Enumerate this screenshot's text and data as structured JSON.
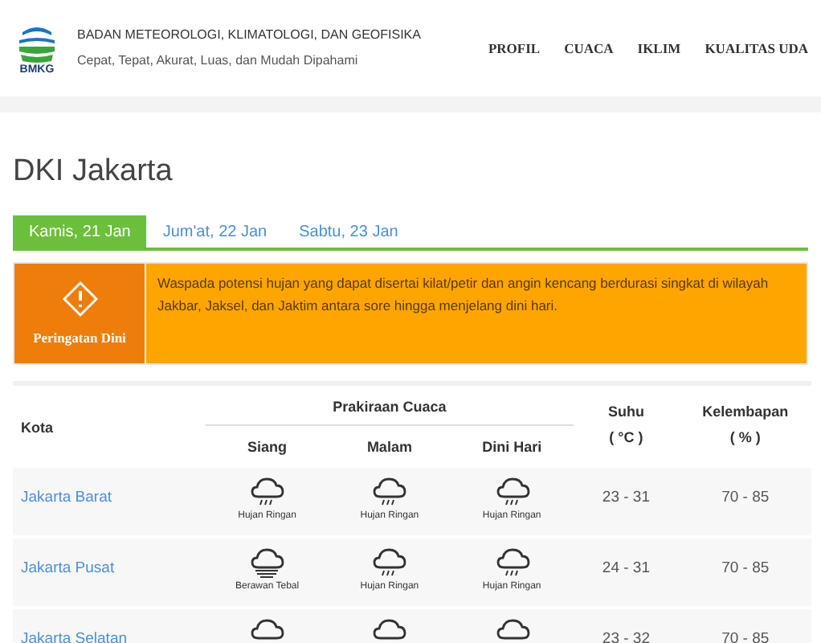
{
  "header": {
    "org_name": "BADAN METEOROLOGI, KLIMATOLOGI, DAN GEOFISIKA",
    "tagline": "Cepat, Tepat, Akurat, Luas, dan Mudah Dipahami",
    "logo_text": "BMKG"
  },
  "nav": [
    "PROFIL",
    "CUACA",
    "IKLIM",
    "KUALITAS UDA"
  ],
  "page_title": "DKI Jakarta",
  "tabs": [
    {
      "label": "Kamis, 21 Jan",
      "selected": true
    },
    {
      "label": "Jum'at, 22 Jan",
      "selected": false
    },
    {
      "label": "Sabtu, 23 Jan",
      "selected": false
    }
  ],
  "warning": {
    "label": "Peringatan Dini",
    "text": "Waspada potensi hujan yang dapat disertai kilat/petir dan angin kencang berdurasi singkat di wilayah Jakbar, Jaksel, dan Jaktim antara sore hingga menjelang dini hari."
  },
  "table": {
    "columns": {
      "city": "Kota",
      "forecast": "Prakiraan Cuaca",
      "periods": [
        "Siang",
        "Malam",
        "Dini Hari"
      ],
      "temp": "Suhu",
      "temp_unit": "( °C )",
      "humidity": "Kelembapan",
      "humidity_unit": "( % )"
    },
    "rows": [
      {
        "city": "Jakarta Barat",
        "forecast": [
          {
            "kind": "rain",
            "label": "Hujan Ringan"
          },
          {
            "kind": "rain",
            "label": "Hujan Ringan"
          },
          {
            "kind": "rain",
            "label": "Hujan Ringan"
          }
        ],
        "temp": "23 - 31",
        "humidity": "70 - 85"
      },
      {
        "city": "Jakarta Pusat",
        "forecast": [
          {
            "kind": "overcast",
            "label": "Berawan Tebal"
          },
          {
            "kind": "rain",
            "label": "Hujan Ringan"
          },
          {
            "kind": "rain",
            "label": "Hujan Ringan"
          }
        ],
        "temp": "24 - 31",
        "humidity": "70 - 85"
      },
      {
        "city": "Jakarta Selatan",
        "forecast": [
          {
            "kind": "cloud"
          },
          {
            "kind": "cloud"
          },
          {
            "kind": "cloud"
          }
        ],
        "temp": "23 - 32",
        "humidity": "70 - 85"
      }
    ]
  }
}
